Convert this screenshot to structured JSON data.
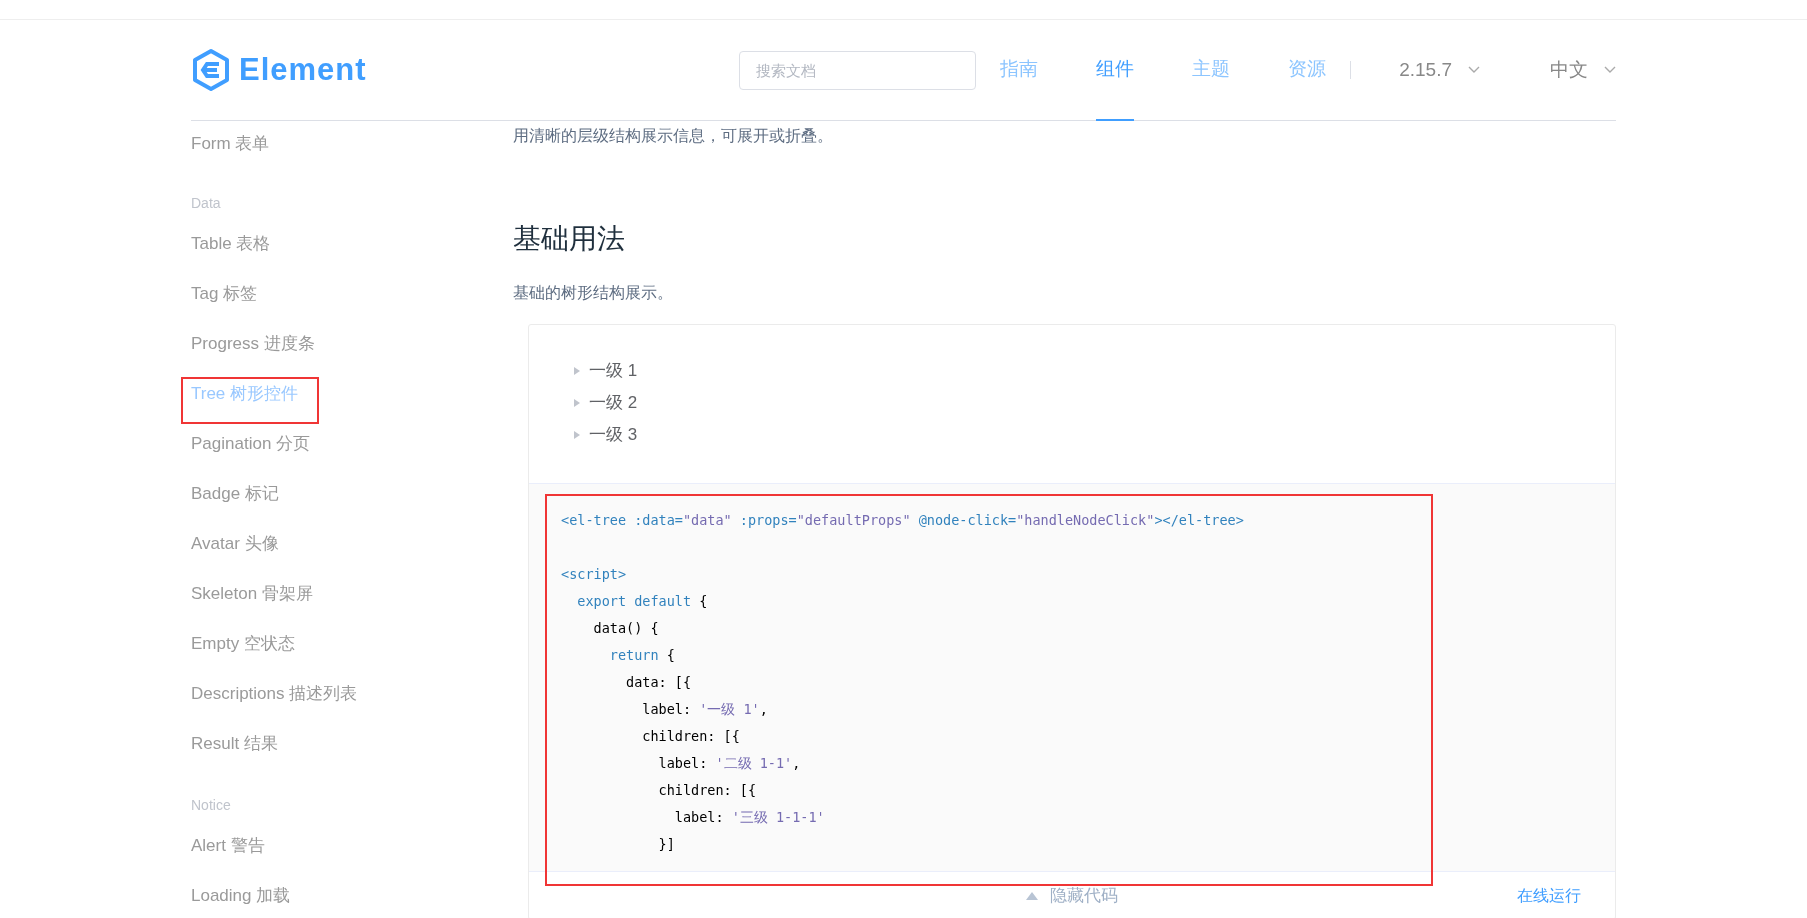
{
  "header": {
    "logo_text": "Element",
    "search": {
      "placeholder": "搜索文档"
    },
    "nav": [
      {
        "label": "指南",
        "selected": false
      },
      {
        "label": "组件",
        "selected": true
      },
      {
        "label": "主题",
        "selected": false
      },
      {
        "label": "资源",
        "selected": false
      }
    ],
    "version": "2.15.7",
    "language": "中文"
  },
  "sidebar": {
    "items": [
      {
        "kind": "item",
        "label": "Form 表单",
        "selected": false
      },
      {
        "kind": "group",
        "label": "Data"
      },
      {
        "kind": "item",
        "label": "Table 表格",
        "selected": false
      },
      {
        "kind": "item",
        "label": "Tag 标签",
        "selected": false
      },
      {
        "kind": "item",
        "label": "Progress 进度条",
        "selected": false
      },
      {
        "kind": "item",
        "label": "Tree 树形控件",
        "selected": true
      },
      {
        "kind": "item",
        "label": "Pagination 分页",
        "selected": false
      },
      {
        "kind": "item",
        "label": "Badge 标记",
        "selected": false
      },
      {
        "kind": "item",
        "label": "Avatar 头像",
        "selected": false
      },
      {
        "kind": "item",
        "label": "Skeleton 骨架屏",
        "selected": false
      },
      {
        "kind": "item",
        "label": "Empty 空状态",
        "selected": false
      },
      {
        "kind": "item",
        "label": "Descriptions 描述列表",
        "selected": false
      },
      {
        "kind": "item",
        "label": "Result 结果",
        "selected": false
      },
      {
        "kind": "group",
        "label": "Notice"
      },
      {
        "kind": "item",
        "label": "Alert 警告",
        "selected": false
      },
      {
        "kind": "item",
        "label": "Loading 加载",
        "selected": false
      }
    ]
  },
  "content": {
    "description": "用清晰的层级结构展示信息，可展开或折叠。",
    "section_title": "基础用法",
    "section_description": "基础的树形结构展示。",
    "demo": {
      "tree": [
        {
          "label": "一级 1",
          "expanded": false
        },
        {
          "label": "一级 2",
          "expanded": false
        },
        {
          "label": "一级 3",
          "expanded": false
        }
      ],
      "code_lines": [
        {
          "kind": "code",
          "tokens": [
            {
              "kind": "tag",
              "text": "<el-tree :data="
            },
            {
              "kind": "string",
              "text": "\"data\""
            },
            {
              "kind": "tag",
              "text": " :props="
            },
            {
              "kind": "string",
              "text": "\"defaultProps\""
            },
            {
              "kind": "tag",
              "text": " @node-click="
            },
            {
              "kind": "string",
              "text": "\"handleNodeClick\""
            },
            {
              "kind": "tag",
              "text": "></el-tree>"
            }
          ]
        },
        {
          "kind": "blank"
        },
        {
          "kind": "code",
          "tokens": [
            {
              "kind": "tag",
              "text": "<script>"
            }
          ]
        },
        {
          "kind": "code",
          "tokens": [
            {
              "kind": "keyword",
              "text": "  export default"
            },
            {
              "kind": "plain",
              "text": " {"
            }
          ]
        },
        {
          "kind": "code",
          "tokens": [
            {
              "kind": "plain",
              "text": "    data() {"
            }
          ]
        },
        {
          "kind": "code",
          "tokens": [
            {
              "kind": "keyword",
              "text": "      return"
            },
            {
              "kind": "plain",
              "text": " {"
            }
          ]
        },
        {
          "kind": "code",
          "tokens": [
            {
              "kind": "plain",
              "text": "        data: [{"
            }
          ]
        },
        {
          "kind": "code",
          "tokens": [
            {
              "kind": "plain",
              "text": "          label: "
            },
            {
              "kind": "string",
              "text": "'一级 1'"
            },
            {
              "kind": "plain",
              "text": ","
            }
          ]
        },
        {
          "kind": "code",
          "tokens": [
            {
              "kind": "plain",
              "text": "          children: [{"
            }
          ]
        },
        {
          "kind": "code",
          "tokens": [
            {
              "kind": "plain",
              "text": "            label: "
            },
            {
              "kind": "string",
              "text": "'二级 1-1'"
            },
            {
              "kind": "plain",
              "text": ","
            }
          ]
        },
        {
          "kind": "code",
          "tokens": [
            {
              "kind": "plain",
              "text": "            children: [{"
            }
          ]
        },
        {
          "kind": "code",
          "tokens": [
            {
              "kind": "plain",
              "text": "              label: "
            },
            {
              "kind": "string",
              "text": "'三级 1-1-1'"
            }
          ]
        },
        {
          "kind": "code",
          "tokens": [
            {
              "kind": "plain",
              "text": "            }]"
            }
          ]
        }
      ],
      "toggle_label": "隐藏代码",
      "run_online": "在线运行"
    }
  }
}
